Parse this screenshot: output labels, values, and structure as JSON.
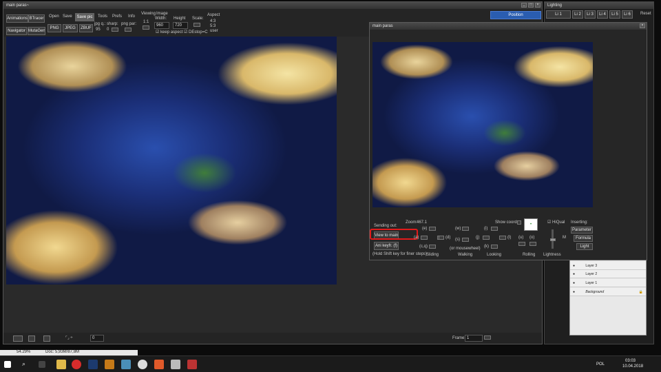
{
  "main_window": {
    "title": "main paras~",
    "toolbar": {
      "animations": "Animations",
      "btracer": "BTracer",
      "navigator": "Navigator",
      "mutagen": "MutaGen",
      "open": "Open",
      "save": "Save",
      "save_pic": "Save pic",
      "tools": "Tools",
      "prefs": "Prefs",
      "info": "Info",
      "png": "PNG",
      "jpeg": "JPEG",
      "zbuf": "ZBUF",
      "jpg_q_label": "jpg q.:",
      "jpg_q_value": "95",
      "sharp_label": "sharp:",
      "sharp_value": "0",
      "png_par_label": "png par:",
      "viewing_label": "Viewing",
      "viewing_value": "1:1",
      "image_label": "Image",
      "width_label": "Width:",
      "width_value": "960",
      "height_label": "Height",
      "height_value": "720",
      "scale_label": "Scale:",
      "aspect_label": "Aspect",
      "aspect_1": "4:3",
      "aspect_2": "5:3",
      "aspect_3": "user",
      "keep_aspect": "keep aspect",
      "de_stop": "DEstop=C"
    },
    "status": {
      "frame_label": "Frame:",
      "frame_value": "1",
      "counter_value": "0"
    }
  },
  "paras_window": {
    "title": "main paras",
    "sending_out": "Sending out:",
    "view_to_main": "View to main",
    "ani_keyfr": "Ani keyfr. (f)",
    "hold_shift": "(Hold Shift key for finer steps)",
    "zoom_label": "Zoom:",
    "zoom_value": "467.1",
    "show_coords": "Show coords",
    "hiqual": "HiQual",
    "inserting": "Inserting:",
    "parameter": "Parameter",
    "formula": "Formula",
    "light": "Light",
    "m_label": "M",
    "key_e": "(e)",
    "key_a": "(a)",
    "key_d": "(d)",
    "key_cq": "(c,q)",
    "key_w": "(w)",
    "key_s": "(s)",
    "key_or_mousewheel": "(or mousewheel)",
    "key_i": "(i)",
    "key_j": "(j)",
    "key_l": "(l)",
    "key_k": "(k)",
    "key_u": "(u)",
    "key_o": "(o)",
    "sliding": "Sliding",
    "walking": "Walking",
    "looking": "Looking",
    "rolling": "Rolling",
    "lightness": "Lightness"
  },
  "right_panel": {
    "position": "Position",
    "lighting": "Lighting",
    "tabs": [
      "Li 1",
      "Li 2",
      "Li 3",
      "Li 4",
      "Li 5",
      "Li 6"
    ],
    "reset": "Reset",
    "layers": [
      "Layer 3",
      "Layer 2",
      "Layer 1",
      "Background"
    ]
  },
  "ps_status": {
    "zoom": "54.29%",
    "doc": "Doc: 5,93M/87,8M"
  },
  "taskbar": {
    "lang": "POL",
    "time": "03:03",
    "date": "10.04.2018"
  },
  "colors": {
    "highlight_red": "#e21b1b",
    "position_blue": "#2a5db0"
  }
}
